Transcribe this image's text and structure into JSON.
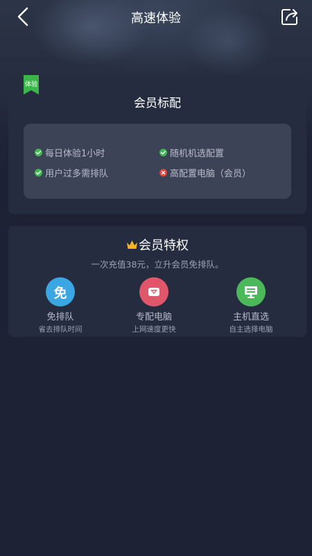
{
  "header": {
    "title": "高速体验",
    "back_icon": "chevron-left-icon",
    "share_icon": "share-icon"
  },
  "standard_card": {
    "badge": "体验",
    "title": "会员标配",
    "features": [
      {
        "label": "每日体验1小时",
        "status": "included"
      },
      {
        "label": "随机机选配置",
        "status": "included"
      },
      {
        "label": "用户过多需排队",
        "status": "included"
      },
      {
        "label": "高配置电脑（会员）",
        "status": "excluded"
      }
    ]
  },
  "vip_card": {
    "title": "会员特权",
    "subtitle": "一次充值38元，立升会员免排队。",
    "perks": [
      {
        "label": "免排队",
        "desc": "省去排队时间",
        "icon_text": "免",
        "icon": "no-queue-icon",
        "color": "#3aa6e2"
      },
      {
        "label": "专配电脑",
        "desc": "上网速度更快",
        "icon": "diamond-icon",
        "color": "#e0566a"
      },
      {
        "label": "主机直选",
        "desc": "自主选择电脑",
        "icon": "monitor-icon",
        "color": "#4bb95a"
      }
    ]
  },
  "colors": {
    "background": "#1d2335",
    "card": "#252c40",
    "check": "#3fb950",
    "cross": "#e0443c",
    "badge": "#3bb44a",
    "crown": "#f5b623"
  }
}
